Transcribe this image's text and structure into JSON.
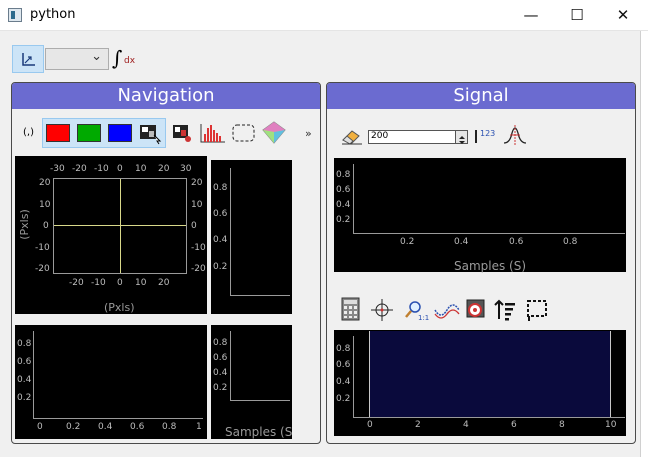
{
  "window": {
    "title": "python",
    "minimize": "—",
    "maximize": "☐",
    "close": "✕"
  },
  "toolbar": {
    "integral": "∫",
    "integral_dx": "dx",
    "combo_arrow": "⌄"
  },
  "colors": {
    "panel_header": "#6b6bd0",
    "plot_bg": "#000000",
    "signal_plot_bg": "#0a0a3c",
    "crosshair": "#d8d88a",
    "red": "#ff0000",
    "green": "#00aa00",
    "blue": "#0000ff"
  },
  "navigation": {
    "title": "Navigation",
    "toolbar": {
      "coord_label": "(,)",
      "more": "»"
    },
    "main_plot": {
      "x_ticks_top": [
        "-30",
        "-20",
        "-10",
        "0",
        "10",
        "20",
        "30"
      ],
      "x_ticks_bottom": [
        "-20",
        "-10",
        "0",
        "10",
        "20"
      ],
      "y_ticks_left": [
        "20",
        "10",
        "0",
        "-10",
        "-20"
      ],
      "y_ticks_right": [
        "20",
        "10",
        "0",
        "-10",
        "-20"
      ],
      "y_label": "(Pxls)",
      "x_label": "(Pxls)"
    },
    "right_plot": {
      "y_ticks": [
        "0.8",
        "0.6",
        "0.4",
        "0.2"
      ]
    },
    "bottom_plot": {
      "y_ticks": [
        "0.8",
        "0.6",
        "0.4",
        "0.2"
      ],
      "x_ticks": [
        "0",
        "0.2",
        "0.4",
        "0.6",
        "0.8",
        "1"
      ]
    },
    "corner_plot": {
      "y_ticks": [
        "0.8",
        "0.6",
        "0.4",
        "0.2"
      ],
      "x_label": "Samples (S"
    }
  },
  "signal": {
    "title": "Signal",
    "toolbar": {
      "spin_value": "200",
      "numeric_label": "123"
    },
    "top_plot": {
      "y_ticks": [
        "0.8",
        "0.6",
        "0.4",
        "0.2"
      ],
      "x_ticks": [
        "0.2",
        "0.4",
        "0.6",
        "0.8"
      ],
      "x_label": "Samples (S)"
    },
    "bottom_plot": {
      "y_ticks": [
        "0.8",
        "0.6",
        "0.4",
        "0.2"
      ],
      "x_ticks": [
        "0",
        "2",
        "4",
        "6",
        "8",
        "10"
      ]
    }
  }
}
